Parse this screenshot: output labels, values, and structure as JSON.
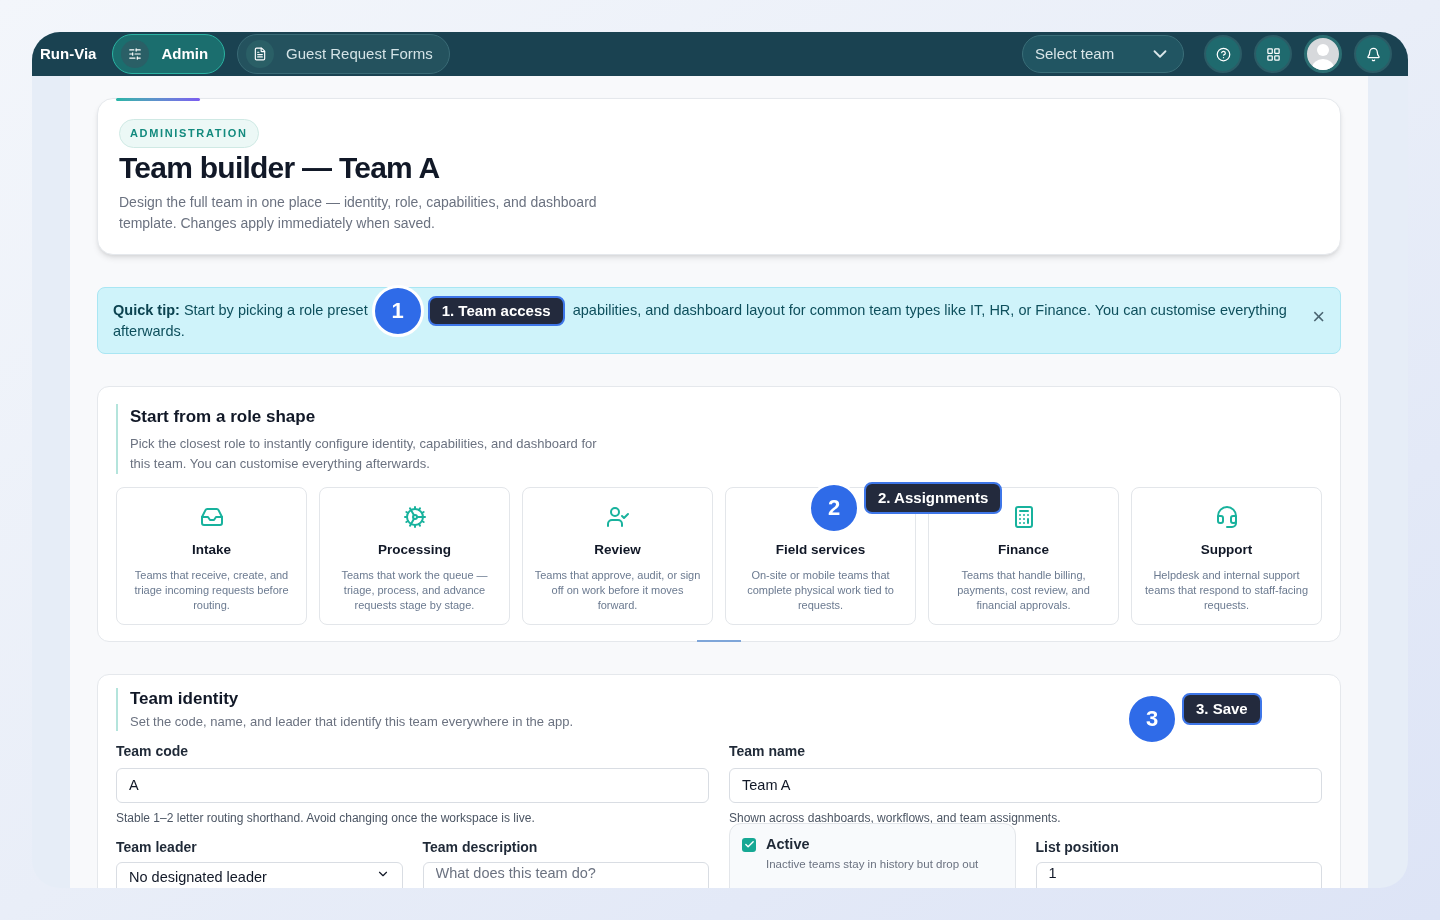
{
  "topbar": {
    "brand": "Run-Via",
    "nav": [
      {
        "label": "Admin",
        "selected": true
      },
      {
        "label": "Guest Request Forms",
        "selected": false
      }
    ],
    "team_select": {
      "placeholder": "Select team"
    }
  },
  "header": {
    "badge": "ADMINISTRATION",
    "title": "Team builder — Team A",
    "description": "Design the full team in one place — identity, role, capabilities, and dashboard template. Changes apply immediately when saved."
  },
  "tip": {
    "label": "Quick tip:",
    "text_before": "Start by picking a role preset",
    "text_after": "apabilities, and dashboard layout for common team types like IT, HR, or Finance. You can customise everything afterwards.",
    "close": "×"
  },
  "markers": [
    {
      "number": "1",
      "label": "1. Team access"
    },
    {
      "number": "2",
      "label": "2. Assignments"
    },
    {
      "number": "3",
      "label": "3. Save"
    }
  ],
  "roles": {
    "title": "Start from a role shape",
    "subtitle": "Pick the closest role to instantly configure identity, capabilities, and dashboard for this team. You can customise everything afterwards.",
    "cards": [
      {
        "name": "Intake",
        "description": "Teams that receive, create, and triage incoming requests before routing."
      },
      {
        "name": "Processing",
        "description": "Teams that work the queue — triage, process, and advance requests stage by stage."
      },
      {
        "name": "Review",
        "description": "Teams that approve, audit, or sign off on work before it moves forward."
      },
      {
        "name": "Field services",
        "description": "On-site or mobile teams that complete physical work tied to requests."
      },
      {
        "name": "Finance",
        "description": "Teams that handle billing, payments, cost review, and financial approvals."
      },
      {
        "name": "Support",
        "description": "Helpdesk and internal support teams that respond to staff-facing requests."
      }
    ]
  },
  "identity": {
    "title": "Team identity",
    "subtitle": "Set the code, name, and leader that identify this team everywhere in the app.",
    "team_code": {
      "label": "Team code",
      "value": "A",
      "help": "Stable 1–2 letter routing shorthand. Avoid changing once the workspace is live."
    },
    "team_name": {
      "label": "Team name",
      "value": "Team A",
      "help": "Shown across dashboards, workflows, and team assignments."
    },
    "team_leader": {
      "label": "Team leader",
      "value": "No designated leader"
    },
    "team_description": {
      "label": "Team description",
      "placeholder": "What does this team do?"
    },
    "active": {
      "label": "Active",
      "checked": true,
      "help": "Inactive teams stay in history but drop out"
    },
    "list_position": {
      "label": "List position",
      "value": "1"
    }
  }
}
